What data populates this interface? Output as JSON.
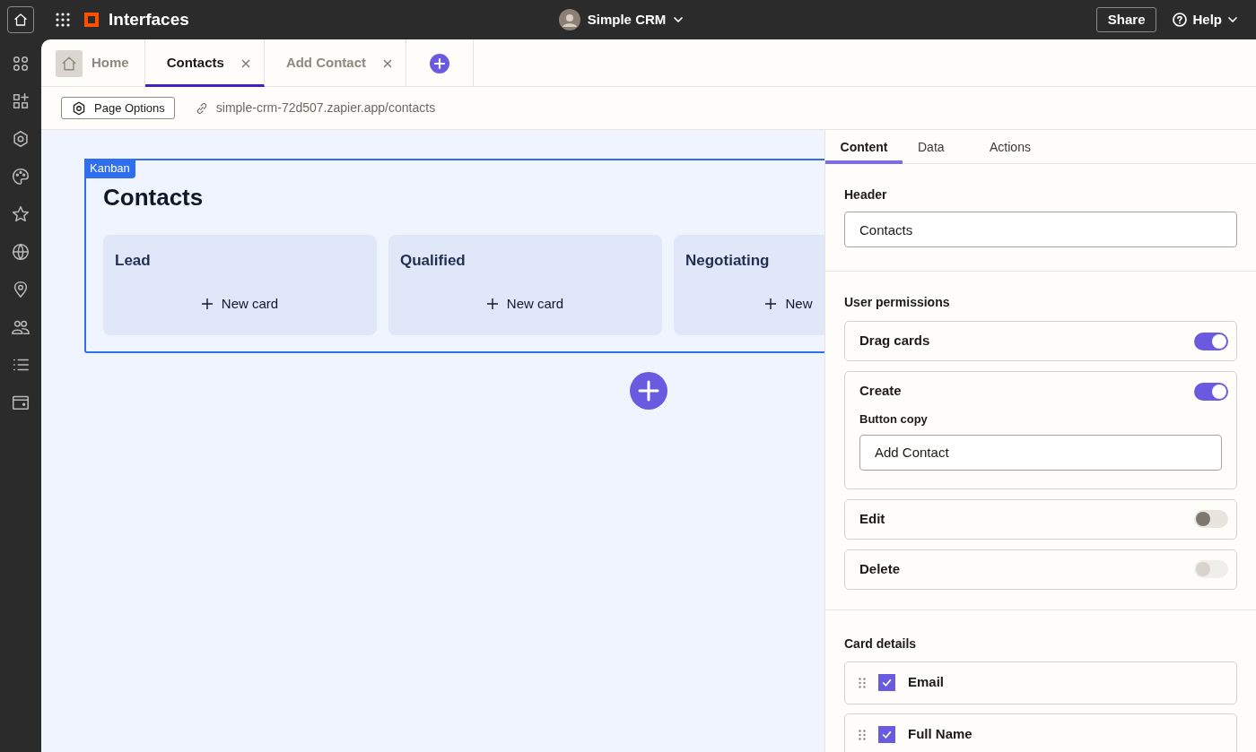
{
  "top_bar": {
    "app_name": "Interfaces",
    "project": "Simple CRM",
    "share": "Share",
    "help": "Help"
  },
  "tabs": [
    {
      "label": "Home",
      "kind": "home",
      "selected": false
    },
    {
      "label": "Contacts",
      "kind": "page",
      "selected": true
    },
    {
      "label": "Add Contact",
      "kind": "page",
      "selected": false
    }
  ],
  "toolbar": {
    "page_options": "Page Options",
    "url": "simple-crm-72d507.zapier.app/contacts"
  },
  "kanban": {
    "badge": "Kanban",
    "title": "Contacts",
    "columns": [
      {
        "name": "Lead",
        "new_card": "New card"
      },
      {
        "name": "Qualified",
        "new_card": "New card"
      },
      {
        "name": "Negotiating",
        "new_card": "New"
      }
    ]
  },
  "panel": {
    "tabs": [
      {
        "label": "Content",
        "selected": true
      },
      {
        "label": "Data",
        "selected": false
      },
      {
        "label": "Actions",
        "selected": false
      }
    ],
    "header_label": "Header",
    "header_value": "Contacts",
    "permissions_label": "User permissions",
    "permissions": [
      {
        "label": "Drag cards",
        "on": true,
        "disabled": false
      },
      {
        "label": "Create",
        "on": true,
        "disabled": false,
        "button_copy_label": "Button copy",
        "button_copy_value": "Add Contact"
      },
      {
        "label": "Edit",
        "on": false,
        "disabled": false
      },
      {
        "label": "Delete",
        "on": false,
        "disabled": true
      }
    ],
    "card_details_label": "Card details",
    "card_details": [
      {
        "label": "Email",
        "checked": true
      },
      {
        "label": "Full Name",
        "checked": true
      }
    ]
  }
}
